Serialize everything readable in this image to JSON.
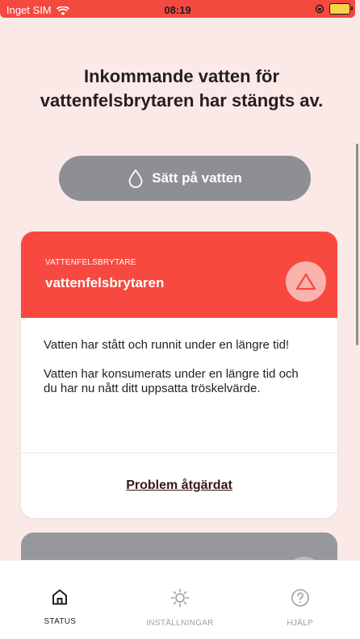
{
  "status_bar": {
    "carrier": "Inget SIM",
    "time": "08:19"
  },
  "headline": "Inkommande vatten för vattenfelsbrytaren har stängts av.",
  "water_button": {
    "label": "Sätt på vatten",
    "icon": "water-drop-icon"
  },
  "alert_card": {
    "category": "VATTENFELSBRYTARE",
    "title": "vattenfelsbrytaren",
    "icon": "warning-triangle-icon",
    "messages": [
      "Vatten har stått och runnit under en längre tid!",
      "Vatten har konsumerats under en längre tid och du har nu nått ditt uppsatta tröskelvärde."
    ],
    "action_label": "Problem åtgärdat"
  },
  "tabs": [
    {
      "label": "STATUS",
      "icon": "home-icon",
      "active": true
    },
    {
      "label": "INSTÄLLNINGAR",
      "icon": "settings-icon",
      "active": false
    },
    {
      "label": "HJÄLP",
      "icon": "help-icon",
      "active": false
    }
  ],
  "colors": {
    "alert": "#f7493f",
    "background": "#fbe9e8",
    "button": "#8e8f94"
  }
}
